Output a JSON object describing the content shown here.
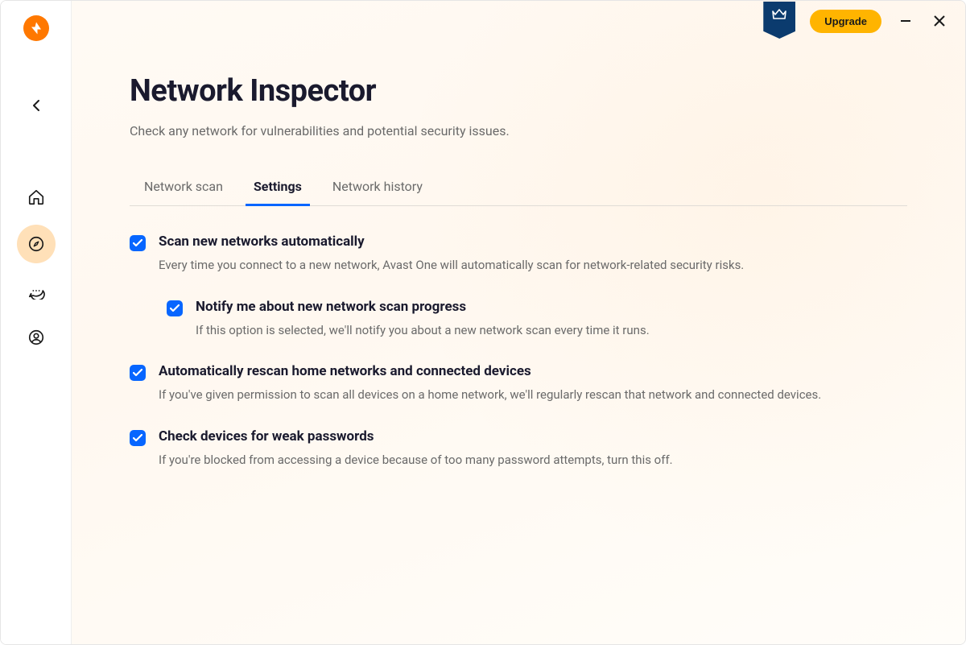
{
  "titlebar": {
    "upgrade_label": "Upgrade"
  },
  "page": {
    "title": "Network Inspector",
    "subtitle": "Check any network for vulnerabilities and potential security issues."
  },
  "tabs": {
    "network_scan": "Network scan",
    "settings": "Settings",
    "network_history": "Network history"
  },
  "settings": {
    "scan_auto": {
      "title": "Scan new networks automatically",
      "desc": "Every time you connect to a new network, Avast One will automatically scan for network-related security risks."
    },
    "notify": {
      "title": "Notify me about new network scan progress",
      "desc": "If this option is selected, we'll notify you about a new network scan every time it runs."
    },
    "rescan": {
      "title": "Automatically rescan home networks and connected devices",
      "desc": "If you've given permission to scan all devices on a home network, we'll regularly rescan that network and connected devices."
    },
    "weak_pw": {
      "title": "Check devices for weak passwords",
      "desc": "If you're blocked from accessing a device because of too many password attempts, turn this off."
    }
  },
  "sidebar": {
    "items": [
      "home",
      "explore",
      "messages",
      "account"
    ]
  }
}
